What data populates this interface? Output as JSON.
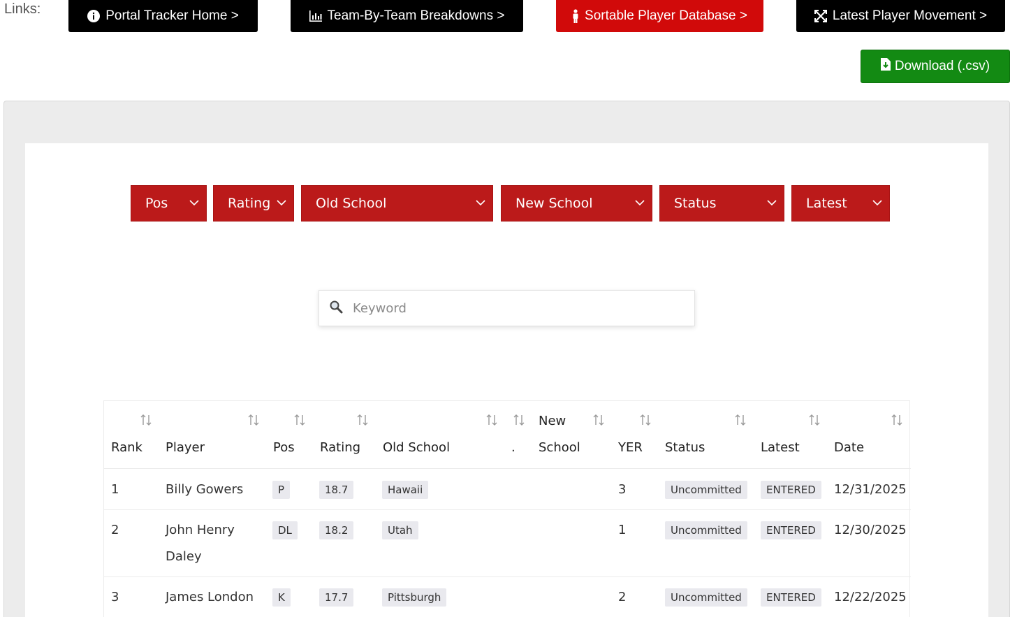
{
  "links_label": "Links:",
  "nav": [
    {
      "label": "Portal Tracker Home >",
      "icon": "info-circle-icon"
    },
    {
      "label": "Team-By-Team Breakdowns >",
      "icon": "bar-chart-icon"
    },
    {
      "label": "Sortable Player Database >",
      "icon": "person-icon"
    },
    {
      "label": "Latest Player Movement >",
      "icon": "arrows-expand-icon"
    }
  ],
  "download": {
    "label": "Download (.csv)",
    "icon": "file-download-icon"
  },
  "filters": [
    "Pos",
    "Rating",
    "Old School",
    "New School",
    "Status",
    "Latest"
  ],
  "search": {
    "placeholder": "Keyword",
    "value": ""
  },
  "table": {
    "headers": {
      "rank": "Rank",
      "player": "Player",
      "pos": "Pos",
      "rating": "Rating",
      "old_school": "Old School",
      "dot": ".",
      "new_school_1": "New",
      "new_school_2": "School",
      "yer": "YER",
      "status": "Status",
      "latest": "Latest",
      "date": "Date"
    },
    "rows": [
      {
        "rank": "1",
        "player_1": "Billy Gowers",
        "player_2": "",
        "pos": "P",
        "rating": "18.7",
        "old_school": "Hawaii",
        "yer": "3",
        "status": "Uncommitted",
        "latest": "ENTERED",
        "date": "12/31/2025"
      },
      {
        "rank": "2",
        "player_1": "John Henry",
        "player_2": "Daley",
        "pos": "DL",
        "rating": "18.2",
        "old_school": "Utah",
        "yer": "1",
        "status": "Uncommitted",
        "latest": "ENTERED",
        "date": "12/30/2025"
      },
      {
        "rank": "3",
        "player_1": "James London",
        "player_2": "",
        "pos": "K",
        "rating": "17.7",
        "old_school": "Pittsburgh",
        "yer": "2",
        "status": "Uncommitted",
        "latest": "ENTERED",
        "date": "12/22/2025"
      }
    ]
  },
  "colors": {
    "nav_black": "#000000",
    "nav_red": "#d10a0a",
    "filter_red": "#bb1a1a",
    "download_green": "#138a13"
  }
}
